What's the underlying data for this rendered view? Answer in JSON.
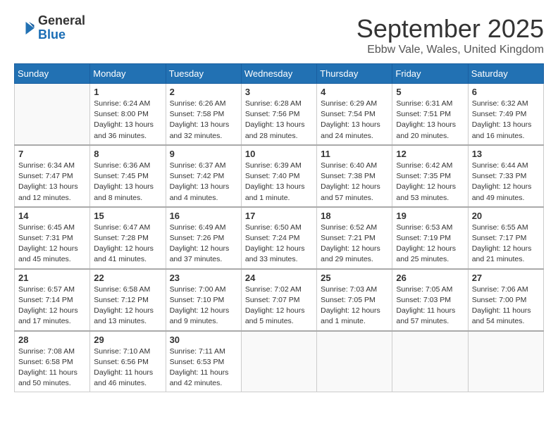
{
  "logo": {
    "general": "General",
    "blue": "Blue"
  },
  "header": {
    "month": "September 2025",
    "location": "Ebbw Vale, Wales, United Kingdom"
  },
  "days_of_week": [
    "Sunday",
    "Monday",
    "Tuesday",
    "Wednesday",
    "Thursday",
    "Friday",
    "Saturday"
  ],
  "weeks": [
    [
      {
        "day": "",
        "info": ""
      },
      {
        "day": "1",
        "info": "Sunrise: 6:24 AM\nSunset: 8:00 PM\nDaylight: 13 hours\nand 36 minutes."
      },
      {
        "day": "2",
        "info": "Sunrise: 6:26 AM\nSunset: 7:58 PM\nDaylight: 13 hours\nand 32 minutes."
      },
      {
        "day": "3",
        "info": "Sunrise: 6:28 AM\nSunset: 7:56 PM\nDaylight: 13 hours\nand 28 minutes."
      },
      {
        "day": "4",
        "info": "Sunrise: 6:29 AM\nSunset: 7:54 PM\nDaylight: 13 hours\nand 24 minutes."
      },
      {
        "day": "5",
        "info": "Sunrise: 6:31 AM\nSunset: 7:51 PM\nDaylight: 13 hours\nand 20 minutes."
      },
      {
        "day": "6",
        "info": "Sunrise: 6:32 AM\nSunset: 7:49 PM\nDaylight: 13 hours\nand 16 minutes."
      }
    ],
    [
      {
        "day": "7",
        "info": "Sunrise: 6:34 AM\nSunset: 7:47 PM\nDaylight: 13 hours\nand 12 minutes."
      },
      {
        "day": "8",
        "info": "Sunrise: 6:36 AM\nSunset: 7:45 PM\nDaylight: 13 hours\nand 8 minutes."
      },
      {
        "day": "9",
        "info": "Sunrise: 6:37 AM\nSunset: 7:42 PM\nDaylight: 13 hours\nand 4 minutes."
      },
      {
        "day": "10",
        "info": "Sunrise: 6:39 AM\nSunset: 7:40 PM\nDaylight: 13 hours\nand 1 minute."
      },
      {
        "day": "11",
        "info": "Sunrise: 6:40 AM\nSunset: 7:38 PM\nDaylight: 12 hours\nand 57 minutes."
      },
      {
        "day": "12",
        "info": "Sunrise: 6:42 AM\nSunset: 7:35 PM\nDaylight: 12 hours\nand 53 minutes."
      },
      {
        "day": "13",
        "info": "Sunrise: 6:44 AM\nSunset: 7:33 PM\nDaylight: 12 hours\nand 49 minutes."
      }
    ],
    [
      {
        "day": "14",
        "info": "Sunrise: 6:45 AM\nSunset: 7:31 PM\nDaylight: 12 hours\nand 45 minutes."
      },
      {
        "day": "15",
        "info": "Sunrise: 6:47 AM\nSunset: 7:28 PM\nDaylight: 12 hours\nand 41 minutes."
      },
      {
        "day": "16",
        "info": "Sunrise: 6:49 AM\nSunset: 7:26 PM\nDaylight: 12 hours\nand 37 minutes."
      },
      {
        "day": "17",
        "info": "Sunrise: 6:50 AM\nSunset: 7:24 PM\nDaylight: 12 hours\nand 33 minutes."
      },
      {
        "day": "18",
        "info": "Sunrise: 6:52 AM\nSunset: 7:21 PM\nDaylight: 12 hours\nand 29 minutes."
      },
      {
        "day": "19",
        "info": "Sunrise: 6:53 AM\nSunset: 7:19 PM\nDaylight: 12 hours\nand 25 minutes."
      },
      {
        "day": "20",
        "info": "Sunrise: 6:55 AM\nSunset: 7:17 PM\nDaylight: 12 hours\nand 21 minutes."
      }
    ],
    [
      {
        "day": "21",
        "info": "Sunrise: 6:57 AM\nSunset: 7:14 PM\nDaylight: 12 hours\nand 17 minutes."
      },
      {
        "day": "22",
        "info": "Sunrise: 6:58 AM\nSunset: 7:12 PM\nDaylight: 12 hours\nand 13 minutes."
      },
      {
        "day": "23",
        "info": "Sunrise: 7:00 AM\nSunset: 7:10 PM\nDaylight: 12 hours\nand 9 minutes."
      },
      {
        "day": "24",
        "info": "Sunrise: 7:02 AM\nSunset: 7:07 PM\nDaylight: 12 hours\nand 5 minutes."
      },
      {
        "day": "25",
        "info": "Sunrise: 7:03 AM\nSunset: 7:05 PM\nDaylight: 12 hours\nand 1 minute."
      },
      {
        "day": "26",
        "info": "Sunrise: 7:05 AM\nSunset: 7:03 PM\nDaylight: 11 hours\nand 57 minutes."
      },
      {
        "day": "27",
        "info": "Sunrise: 7:06 AM\nSunset: 7:00 PM\nDaylight: 11 hours\nand 54 minutes."
      }
    ],
    [
      {
        "day": "28",
        "info": "Sunrise: 7:08 AM\nSunset: 6:58 PM\nDaylight: 11 hours\nand 50 minutes."
      },
      {
        "day": "29",
        "info": "Sunrise: 7:10 AM\nSunset: 6:56 PM\nDaylight: 11 hours\nand 46 minutes."
      },
      {
        "day": "30",
        "info": "Sunrise: 7:11 AM\nSunset: 6:53 PM\nDaylight: 11 hours\nand 42 minutes."
      },
      {
        "day": "",
        "info": ""
      },
      {
        "day": "",
        "info": ""
      },
      {
        "day": "",
        "info": ""
      },
      {
        "day": "",
        "info": ""
      }
    ]
  ]
}
